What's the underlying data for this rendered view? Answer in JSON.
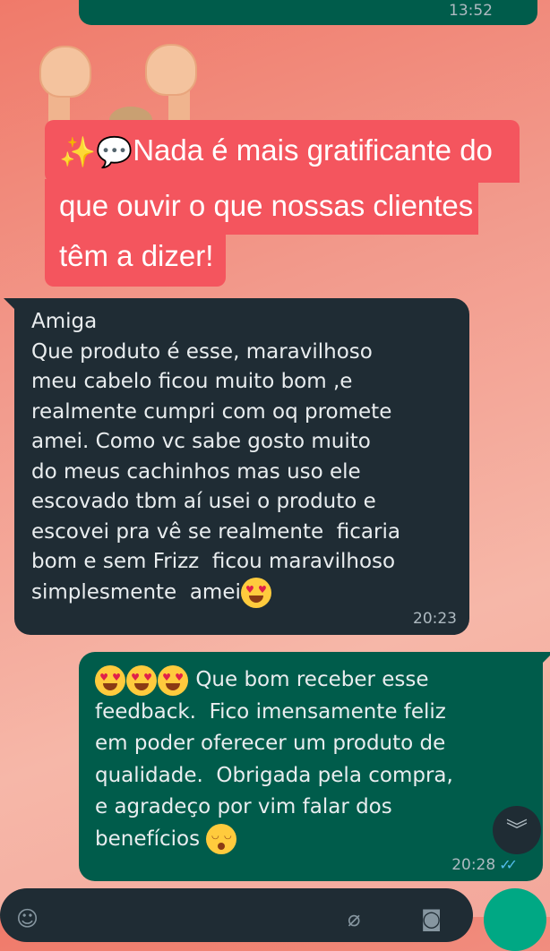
{
  "previous_message": {
    "time": "13:52",
    "status": "read-ticks"
  },
  "caption": {
    "line1_emojis": "✨💬",
    "line1": "Nada é mais gratificante do",
    "line2": "que ouvir o que nossas clientes",
    "line3": "têm a dizer!"
  },
  "incoming": {
    "text": "Amiga\nQue produto é esse, maravilhoso\nmeu cabelo ficou muito bom ,e\nrealmente cumpri com oq promete\namei. Como vc sabe gosto muito\ndo meus cachinhos mas uso ele\nescovado tbm aí usei o produto e\nescovei pra vê se realmente  ficaria\nbom e sem Frizz  ficou maravilhoso\nsimplesmente  amei",
    "emoji": "heart-eyes",
    "time": "20:23"
  },
  "outgoing": {
    "text_first": "Que bom receber esse",
    "text_rest": "feedback.  Fico imensamente feliz\nem poder oferecer um produto de\nqualidade.  Obrigada pela compra,\ne agradeço por vim falar dos\nbenefícios",
    "leading_emojis": [
      "heart-eyes",
      "heart-eyes",
      "heart-eyes"
    ],
    "trailing_emoji": "kissing-face",
    "time": "20:28",
    "status": "read-ticks"
  },
  "icons": {
    "scroll_down": "double-chevron-down-icon",
    "emoji": "emoji-icon",
    "attach": "paperclip-icon",
    "camera": "camera-icon",
    "mic": "mic-icon"
  },
  "colors": {
    "outgoing_bubble": "#005c4b",
    "incoming_bubble": "#1f2c34",
    "caption_bg": "#f4555e",
    "read_ticks": "#53bdeb"
  }
}
